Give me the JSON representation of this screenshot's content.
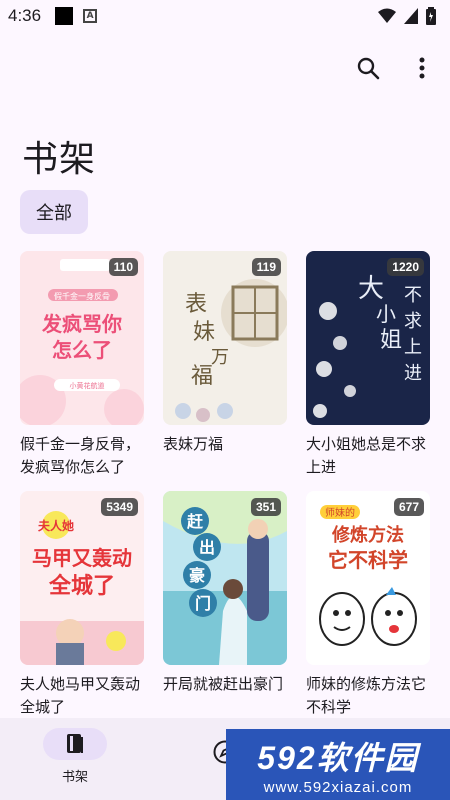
{
  "status_bar": {
    "time": "4:36"
  },
  "page": {
    "title": "书架"
  },
  "filter": {
    "chip_label": "全部"
  },
  "books": [
    {
      "title": "假千金一身反骨，发疯骂你怎么了",
      "count": "110",
      "cover_text": "发疯骂你怎么了",
      "cover_sub": "假千金一身反骨",
      "cover_author": "小黄花航道",
      "accent": "#ec6f8f"
    },
    {
      "title": "表妹万福",
      "count": "119",
      "cover_text": "表妹万福",
      "accent": "#7a6a4a"
    },
    {
      "title": "大小姐她总是不求上进",
      "count": "1220",
      "cover_text": "大小姐不求上进",
      "accent": "#1c2a4f"
    },
    {
      "title": "夫人她马甲又轰动全城了",
      "count": "5349",
      "cover_text": "马甲又轰动全城了",
      "cover_sub": "夫人她",
      "accent": "#e5353a"
    },
    {
      "title": "开局就被赶出豪门",
      "count": "351",
      "cover_text": "赶出豪门",
      "accent": "#3a8fb8"
    },
    {
      "title": "师妹的修炼方法它不科学",
      "count": "677",
      "cover_text": "修炼方法它不科学",
      "cover_sub": "师妹的",
      "accent": "#d2452a"
    }
  ],
  "nav": {
    "shelf_label": "书架"
  },
  "watermark": {
    "main": "592软件园",
    "sub": "www.592xiazai.com"
  }
}
